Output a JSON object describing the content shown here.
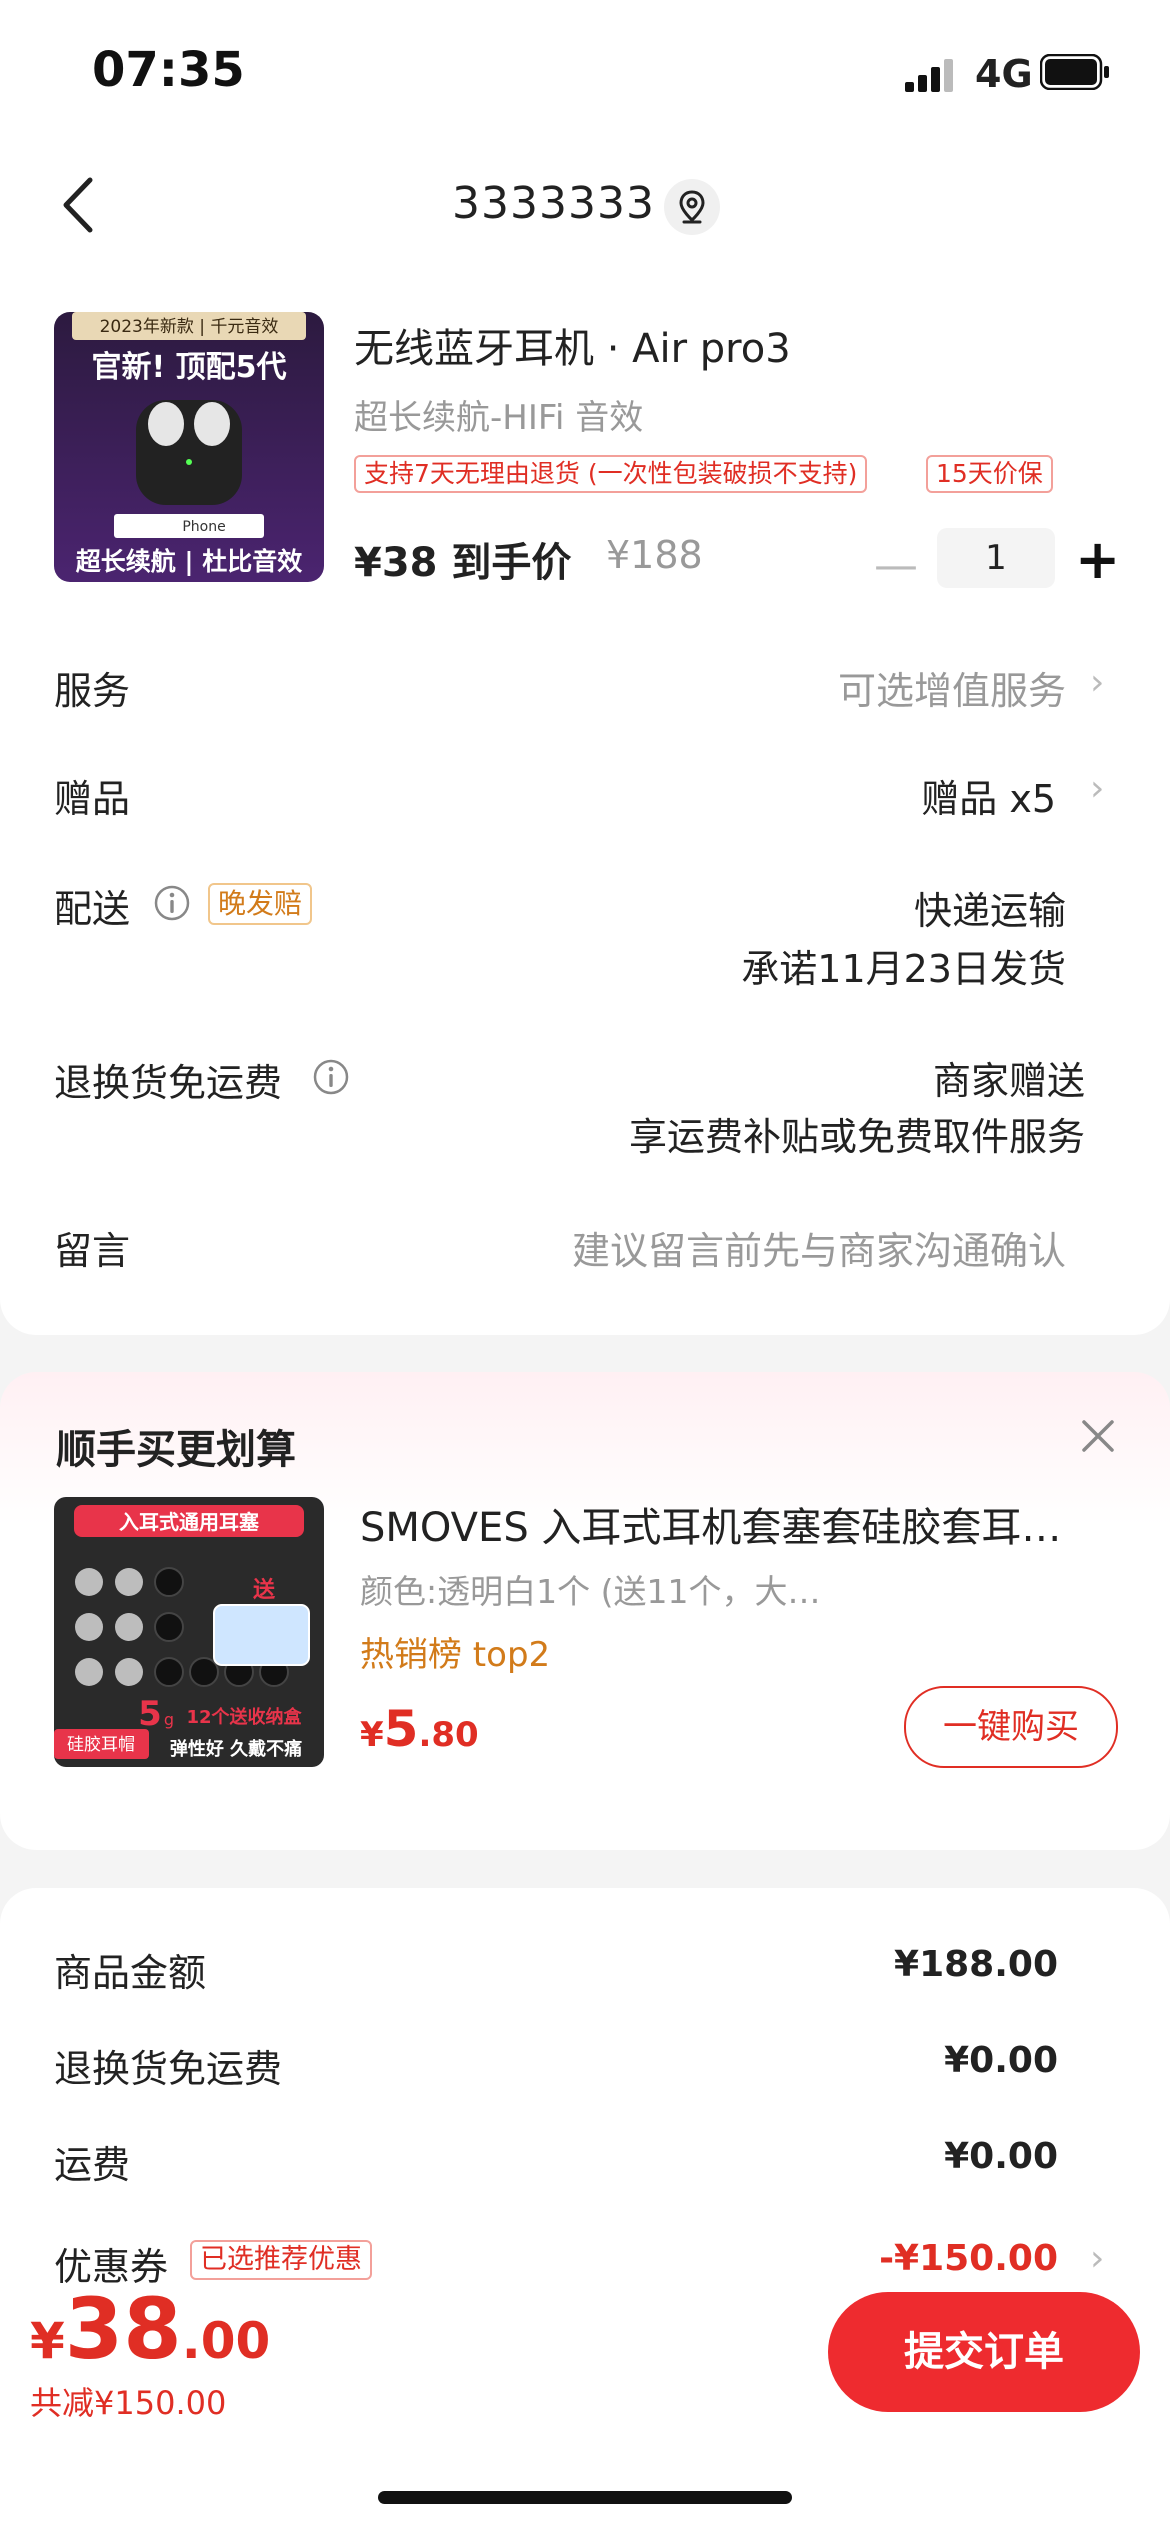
{
  "status_bar": {
    "time": "07:35",
    "network": "4G"
  },
  "nav": {
    "title": "3333333"
  },
  "product": {
    "title": "无线蓝牙耳机 · Air pro3",
    "subtitle": "超长续航-HIFi 音效",
    "tags": [
      "支持7天无理由退货 (一次性包装破损不支持)",
      "15天价保"
    ],
    "price_now": "¥38 到手价",
    "price_old": "¥188",
    "quantity": "1",
    "thumb": {
      "top_banner": "2023年新款 | 千元音效",
      "headline": "官新! 顶配5代",
      "box_label": "Phone",
      "bottom_banner": "超长续航 | 杜比音效"
    }
  },
  "rows": {
    "service": {
      "label": "服务",
      "value": "可选增值服务"
    },
    "gift": {
      "label": "赠品",
      "value": "赠品 x5"
    },
    "delivery": {
      "label": "配送",
      "badge": "晚发赔",
      "value1": "快递运输",
      "value2": "承诺11月23日发货"
    },
    "return_free": {
      "label": "退换货免运费",
      "value1": "商家赠送",
      "value2": "享运费补贴或免费取件服务"
    },
    "message": {
      "label": "留言",
      "placeholder": "建议留言前先与商家沟通确认"
    }
  },
  "recommend": {
    "title": "顺手买更划算",
    "item": {
      "name": "SMOVES 入耳式耳机套塞套硅胶套耳…",
      "spec": "颜色:透明白1个 (送11个，大…",
      "rank": "热销榜 top2",
      "price_symbol": "¥",
      "price_int": "5",
      "price_dec": ".80",
      "buy_label": "一键购买",
      "thumb": {
        "banner": "入耳式通用耳塞",
        "gift": "送",
        "promo": "12个送收纳盒",
        "promo_num": "5",
        "promo_unit": "g",
        "badge": "硅胶耳帽",
        "slogan": "弹性好 久戴不痛"
      }
    }
  },
  "summary": {
    "goods_amount": {
      "label": "商品金额",
      "value": "¥188.00"
    },
    "return_free": {
      "label": "退换货免运费",
      "value": "¥0.00"
    },
    "shipping": {
      "label": "运费",
      "value": "¥0.00"
    },
    "coupon": {
      "label": "优惠券",
      "badge": "已选推荐优惠",
      "value": "-¥150.00"
    }
  },
  "bottom_bar": {
    "price_symbol": "¥",
    "price_int": "38",
    "price_dec": ".00",
    "saved": "共减¥150.00",
    "submit_label": "提交订单"
  },
  "colors": {
    "accent": "#e02e24",
    "submit_bg": "#ee2b2f",
    "orange": "#d27b1a"
  }
}
